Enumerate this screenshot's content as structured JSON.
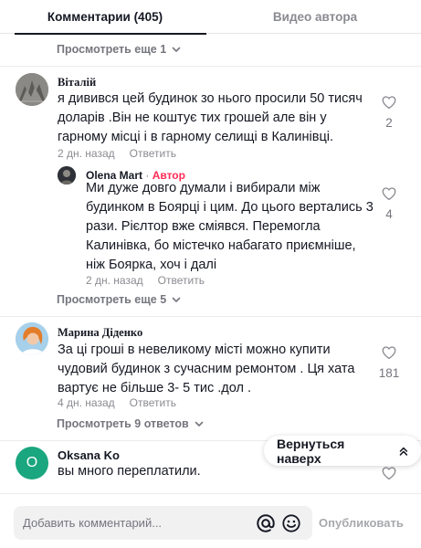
{
  "tabs": [
    {
      "label": "Комментарии (405)"
    },
    {
      "label": "Видео автора"
    }
  ],
  "show_more_1": "Просмотреть еще 1",
  "comments": [
    {
      "author": "Віталій",
      "text_lines": [
        "я дивився цей будинок зо нього просили 50 тисяч",
        "доларів .Він не коштує тих грошей але він у",
        "гарному місці і в гарному селищі в Калинівці."
      ],
      "time": "2 дн. назад",
      "reply_label": "Ответить",
      "likes": "2",
      "replies": [
        {
          "author": "Olena Mart",
          "separator": "·",
          "author_badge": "Автор",
          "text_lines": [
            "Ми дуже довго думали і вибирали між",
            "будинком в Боярці і цим. До цього вертались 3",
            "рази. Рієлтор вже сміявся. Перемогла",
            "Калинівка, бо містечко набагато приємніше,",
            "ніж Боярка, хоч і далі"
          ],
          "time": "2 дн. назад",
          "reply_label": "Ответить",
          "likes": "4"
        }
      ],
      "show_more_replies": "Просмотреть еще 5"
    },
    {
      "author": "Марина Діденко",
      "text_lines": [
        "За ці гроші в невеликому місті можно купити",
        "чудовий будинок з сучасним ремонтом . Ця хата",
        "вартує не більше 3- 5 тис .дол ."
      ],
      "time": "4 дн. назад",
      "reply_label": "Ответить",
      "likes": "181",
      "show_more_replies": "Просмотреть 9 ответов"
    },
    {
      "author": "Oksana Ko",
      "avatar_letter": "O",
      "avatar_color": "#1aa67f",
      "text_lines": [
        "вы много переплатили."
      ],
      "likes": ""
    }
  ],
  "back_to_top": {
    "label": "Вернуться наверх",
    "icon": "double-chevron-up-icon"
  },
  "composer": {
    "placeholder": "Добавить комментарий...",
    "mention_icon": "at-icon",
    "emoji_icon": "emoji-icon",
    "publish_label": "Опубликовать"
  },
  "colors": {
    "accent": "#fe2c55",
    "text": "#161823",
    "muted": "#8a8b91",
    "teal": "#1aa67f"
  }
}
